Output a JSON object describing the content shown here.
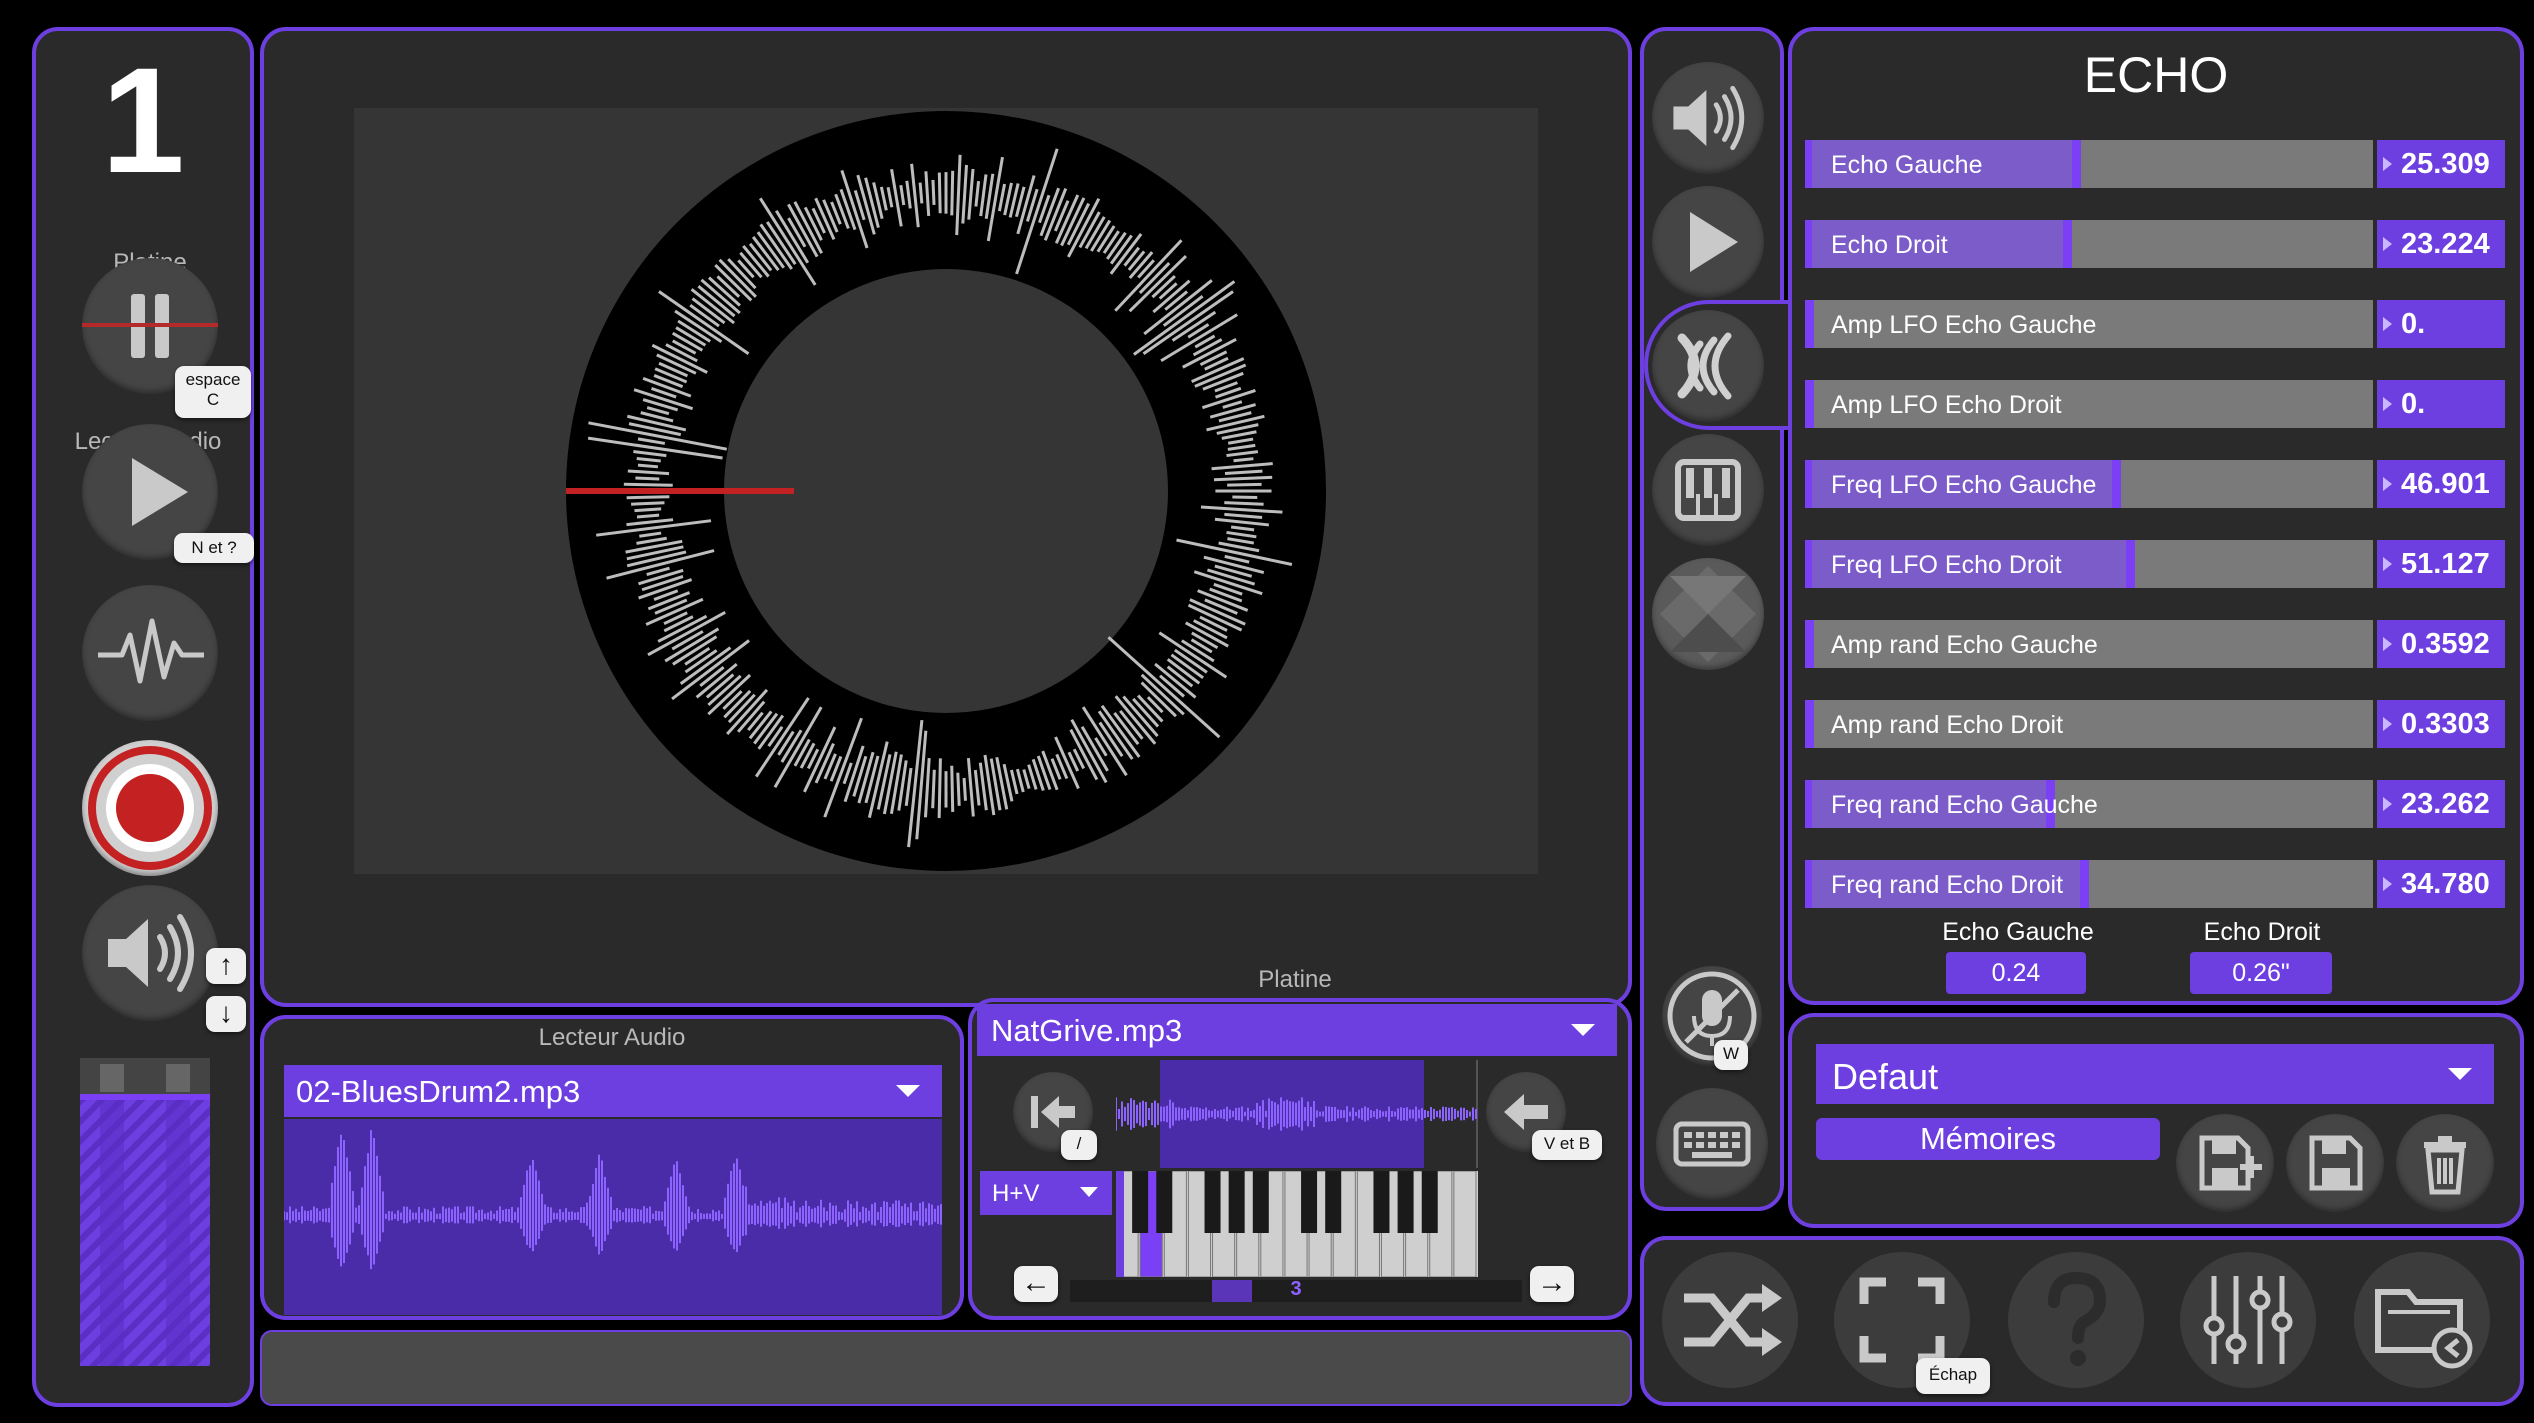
{
  "left": {
    "track_number": "1",
    "platine_label": "Platine",
    "platine_key": "espace\nC",
    "lecteur_label": "Lecteur Audio",
    "lecteur_key": "N et ?",
    "up_arrow": "↑",
    "down_arrow": "↓"
  },
  "lecteur": {
    "title": "Lecteur Audio",
    "file": "02-BluesDrum2.mp3"
  },
  "platine": {
    "title": "Platine",
    "file": "NatGrive.mp3",
    "back_key": "/",
    "fwd_key": "V et B",
    "mode": "H+V",
    "octave": "3",
    "left_arrow": "←",
    "right_arrow": "→"
  },
  "side": {
    "mic_key": "W"
  },
  "echo": {
    "title": "ECHO",
    "params": [
      {
        "label": "Echo Gauche",
        "value": "25.309",
        "level": 0.47
      },
      {
        "label": "Echo Droit",
        "value": "23.224",
        "level": 0.455
      },
      {
        "label": "Amp LFO Echo Gauche",
        "value": "0.",
        "level": 0.0
      },
      {
        "label": "Amp LFO Echo Droit",
        "value": "0.",
        "level": 0.0
      },
      {
        "label": "Freq LFO Echo Gauche",
        "value": "46.901",
        "level": 0.54
      },
      {
        "label": "Freq LFO Echo Droit",
        "value": "51.127",
        "level": 0.565
      },
      {
        "label": "Amp rand Echo Gauche",
        "value": "0.3592",
        "level": 0.0
      },
      {
        "label": "Amp rand Echo Droit",
        "value": "0.3303",
        "level": 0.0
      },
      {
        "label": "Freq rand Echo Gauche",
        "value": "23.262",
        "level": 0.425
      },
      {
        "label": "Freq rand Echo Droit",
        "value": "34.780",
        "level": 0.485
      }
    ],
    "left_label": "Echo Gauche",
    "left_value": "0.24",
    "right_label": "Echo Droit",
    "right_value": "0.26\""
  },
  "presets": {
    "selected": "Defaut",
    "memories_label": "Mémoires"
  },
  "bottom": {
    "fullscreen_key": "Échap"
  },
  "colors": {
    "accent": "#6d3fe0",
    "record": "#cc1f1f",
    "panel": "#2a2a2a"
  }
}
